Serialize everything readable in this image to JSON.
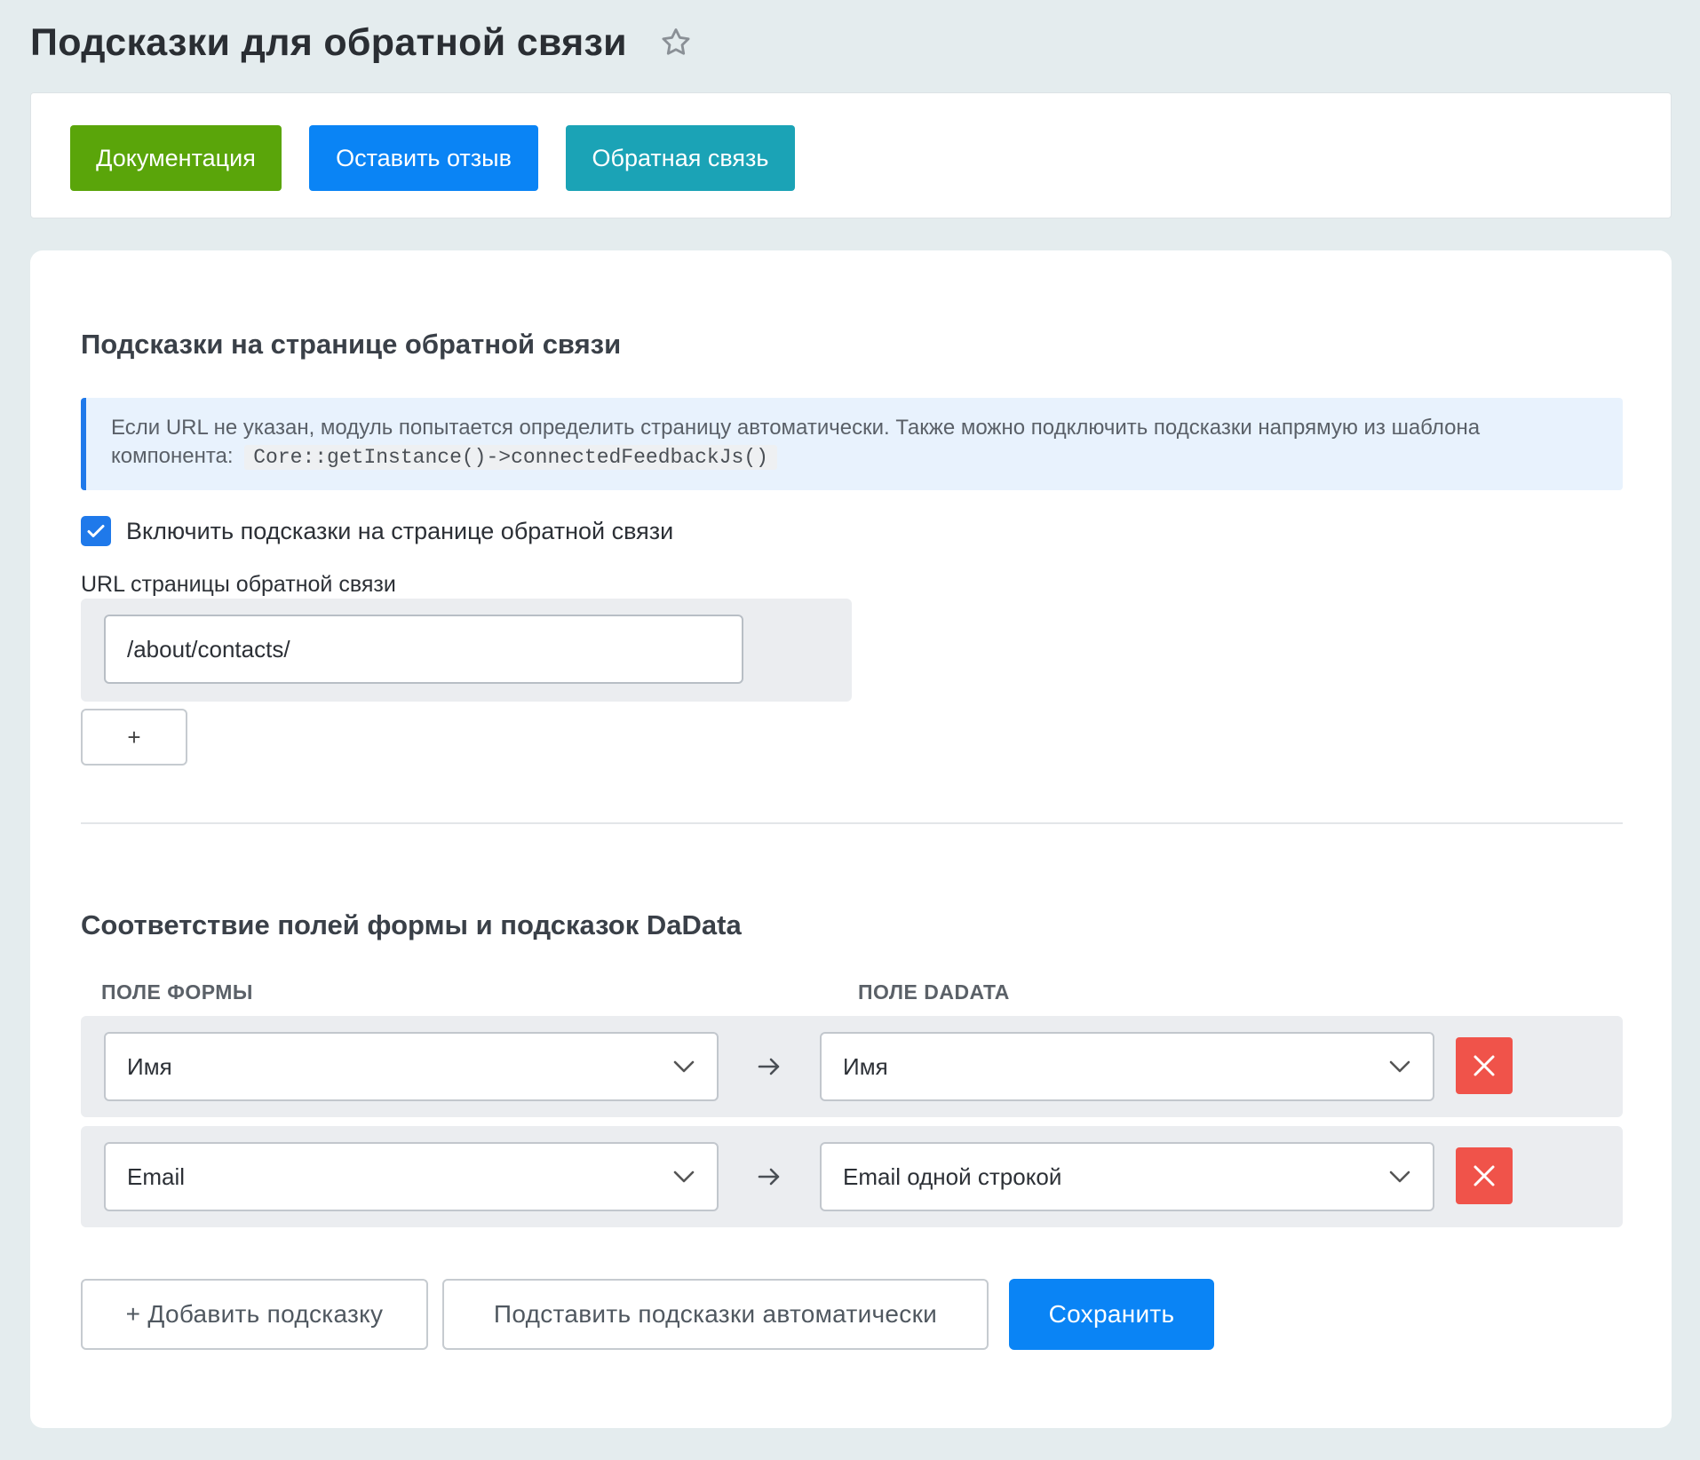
{
  "page": {
    "title": "Подсказки для обратной связи"
  },
  "toolbar": {
    "docs_label": "Документация",
    "review_label": "Оставить отзыв",
    "feedback_label": "Обратная связь"
  },
  "feedback_section": {
    "title": "Подсказки на странице обратной связи",
    "alert_text": "Если URL не указан, модуль попытается определить страницу автоматически. Также можно подключить подсказки напрямую из шаблона компонента:",
    "alert_code": "Core::getInstance()->connectedFeedbackJs()",
    "checkbox_label": "Включить подсказки на странице обратной связи",
    "checkbox_checked": true,
    "url_label": "URL страницы обратной связи",
    "url_value": "/about/contacts/",
    "add_url_label": "+"
  },
  "mapping_section": {
    "title": "Соответствие полей формы и подсказок DaData",
    "col_form": "ПОЛЕ ФОРМЫ",
    "col_dadata": "ПОЛЕ DADATA",
    "rows": [
      {
        "form_field": "Имя",
        "dadata_field": "Имя"
      },
      {
        "form_field": "Email",
        "dadata_field": "Email одной строкой"
      }
    ]
  },
  "actions": {
    "add_label": "+ Добавить подсказку",
    "auto_label": "Подставить подсказки автоматически",
    "save_label": "Сохранить"
  },
  "colors": {
    "docs": "#5aa50a",
    "primary": "#0a84f5",
    "feedback": "#1ba3b6",
    "danger": "#f0534a",
    "background": "#e4ecee"
  }
}
